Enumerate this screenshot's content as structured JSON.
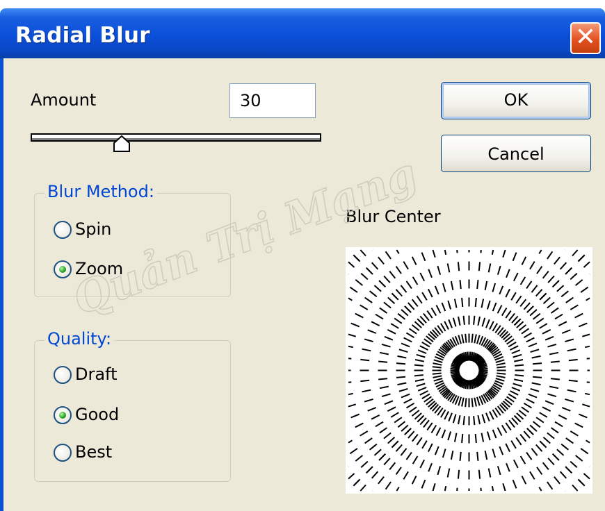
{
  "window": {
    "title": "Radial Blur",
    "close_icon": "close-icon"
  },
  "amount": {
    "label": "Amount",
    "value": "30",
    "slider_fraction": 0.3
  },
  "buttons": {
    "ok": "OK",
    "cancel": "Cancel"
  },
  "blur_method": {
    "legend": "Blur Method:",
    "options": [
      {
        "label": "Spin",
        "selected": false
      },
      {
        "label": "Zoom",
        "selected": true
      }
    ]
  },
  "quality": {
    "legend": "Quality:",
    "options": [
      {
        "label": "Draft",
        "selected": false
      },
      {
        "label": "Good",
        "selected": true
      },
      {
        "label": "Best",
        "selected": false
      }
    ]
  },
  "blur_center": {
    "label": "Blur Center"
  },
  "watermark": "Quản Trị Mạng",
  "colors": {
    "title_bar": "#0a4fd8",
    "dialog_bg": "#ece9d8",
    "legend_text": "#0046d5",
    "close_button": "#e5501f"
  }
}
